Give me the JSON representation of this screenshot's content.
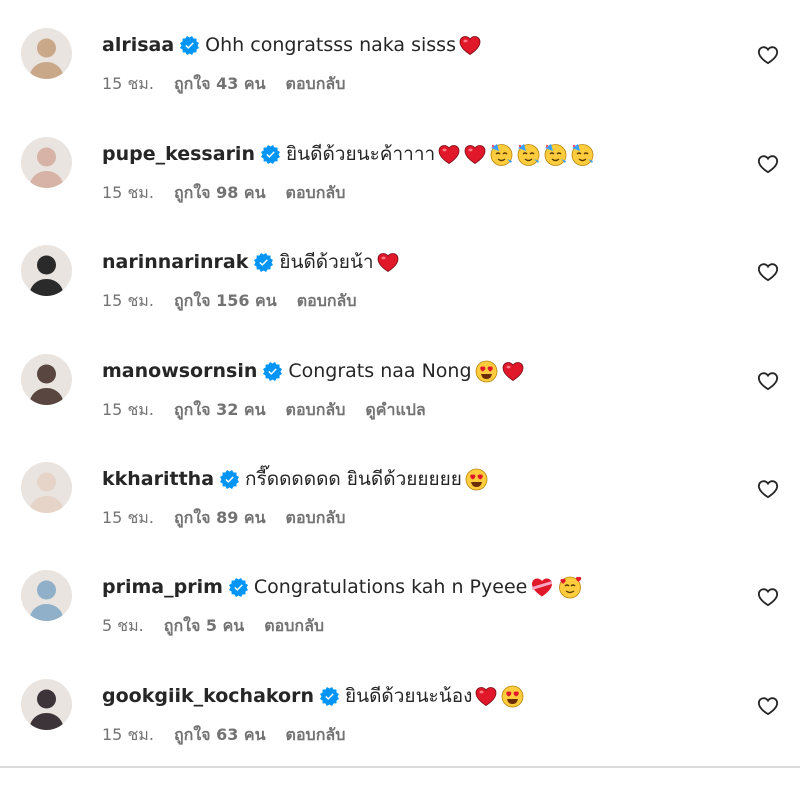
{
  "colors": {
    "verified": "#0095f6",
    "heart_red": "#e0182a",
    "text": "#262626",
    "muted": "#737373"
  },
  "comments": [
    {
      "username": "alrisaa",
      "verified": true,
      "text": "Ohh congratsss naka sisss",
      "emojis": [
        "red-heart"
      ],
      "time": "15 ชม.",
      "likes": "ถูกใจ 43 คน",
      "reply": "ตอบกลับ",
      "avatar": "#c9a88a"
    },
    {
      "username": "pupe_kessarin",
      "verified": true,
      "text": "ยินดีด้วยนะค้าาาา",
      "emojis": [
        "red-heart",
        "red-heart",
        "partying-face",
        "partying-face",
        "partying-face",
        "partying-face"
      ],
      "time": "15 ชม.",
      "likes": "ถูกใจ 98 คน",
      "reply": "ตอบกลับ",
      "avatar": "#d6b3a6"
    },
    {
      "username": "narinnarinrak",
      "verified": true,
      "text": "ยินดีด้วยน้า",
      "emojis": [
        "red-heart"
      ],
      "time": "15 ชม.",
      "likes": "ถูกใจ 156 คน",
      "reply": "ตอบกลับ",
      "avatar": "#2a2a2a"
    },
    {
      "username": "manowsornsin",
      "verified": true,
      "text": "Congrats naa Nong",
      "emojis": [
        "heart-eyes",
        "red-heart"
      ],
      "time": "15 ชม.",
      "likes": "ถูกใจ 32 คน",
      "reply": "ตอบกลับ",
      "translate": "ดูคำแปล",
      "avatar": "#5a4640"
    },
    {
      "username": "kkharittha",
      "verified": true,
      "text": "กรี๊ดดดดดด ยินดีด้วยยยยย",
      "emojis": [
        "heart-eyes"
      ],
      "time": "15 ชม.",
      "likes": "ถูกใจ 89 คน",
      "reply": "ตอบกลับ",
      "avatar": "#e6d4c8"
    },
    {
      "username": "prima_prim",
      "verified": true,
      "text": "Congratulations kah n Pyeee",
      "emojis": [
        "heart-with-ribbon",
        "smiling-hearts"
      ],
      "time": "5 ชม.",
      "likes": "ถูกใจ 5 คน",
      "reply": "ตอบกลับ",
      "avatar": "#8fb0c8"
    },
    {
      "username": "gookgiik_kochakorn",
      "verified": true,
      "text": "ยินดีด้วยนะน้อง",
      "emojis": [
        "red-heart",
        "heart-eyes"
      ],
      "time": "15 ชม.",
      "likes": "ถูกใจ 63 คน",
      "reply": "ตอบกลับ",
      "avatar": "#3c3438"
    }
  ]
}
